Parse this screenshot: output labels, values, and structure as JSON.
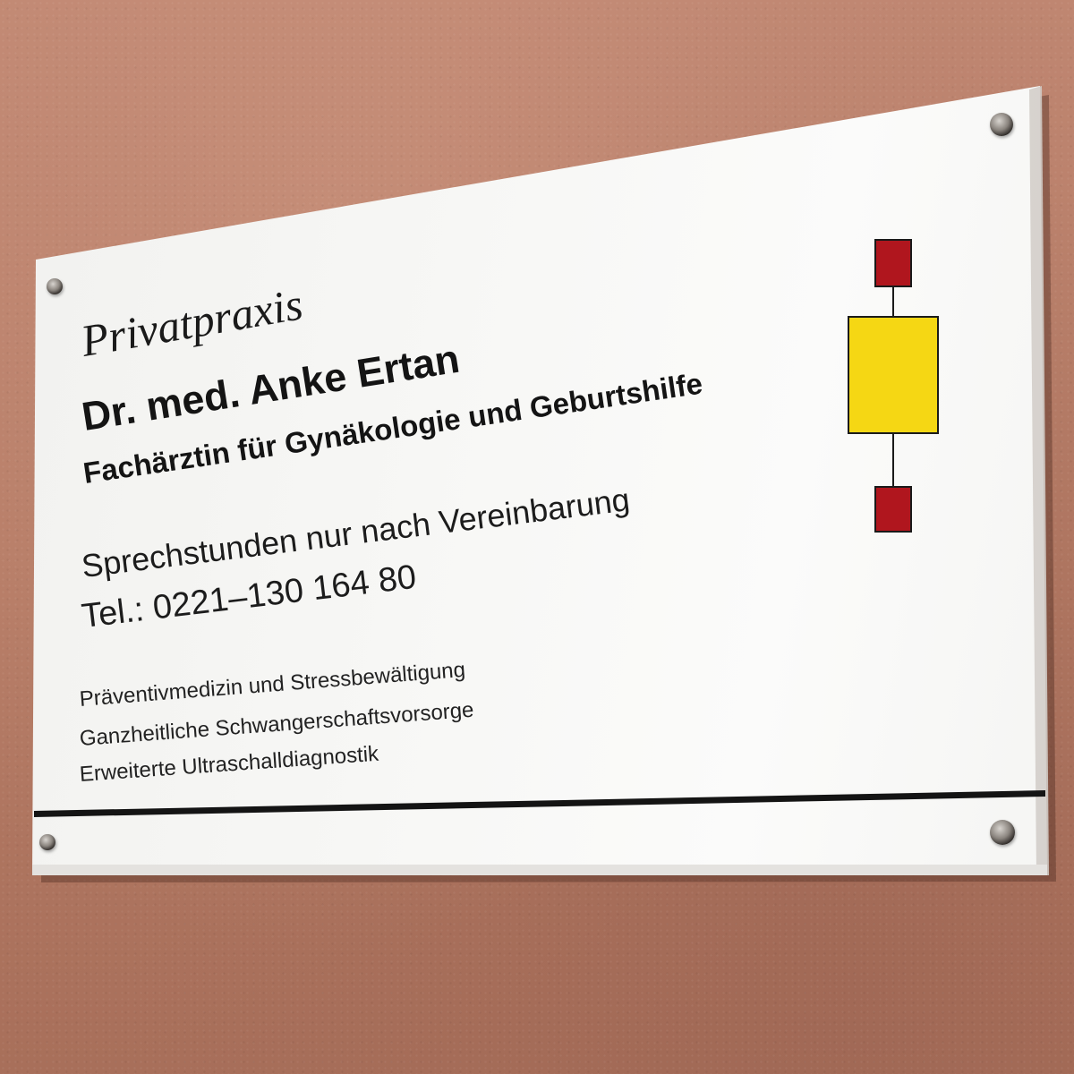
{
  "sign": {
    "title": "Privatpraxis",
    "doctor_name": "Dr. med. Anke Ertan",
    "specialty": "Fachärztin für Gynäkologie und Geburtshilfe",
    "hours": "Sprechstunden nur nach Vereinbarung",
    "phone": "Tel.: 0221–130 164 80",
    "services": [
      "Präventivmedizin und Stressbewältigung",
      "Ganzheitliche Schwangerschaftsvorsorge",
      "Erweiterte Ultraschalldiagnostik"
    ]
  },
  "logo": {
    "icon": "practice-logo-icon",
    "top_square_color": "#b0161e",
    "center_square_color": "#f5d714",
    "bottom_square_color": "#b0161e",
    "connector_color": "#1a1a1a"
  },
  "colors": {
    "wall": "#b9806b",
    "plate": "#f7f7f5",
    "text": "#141414"
  }
}
